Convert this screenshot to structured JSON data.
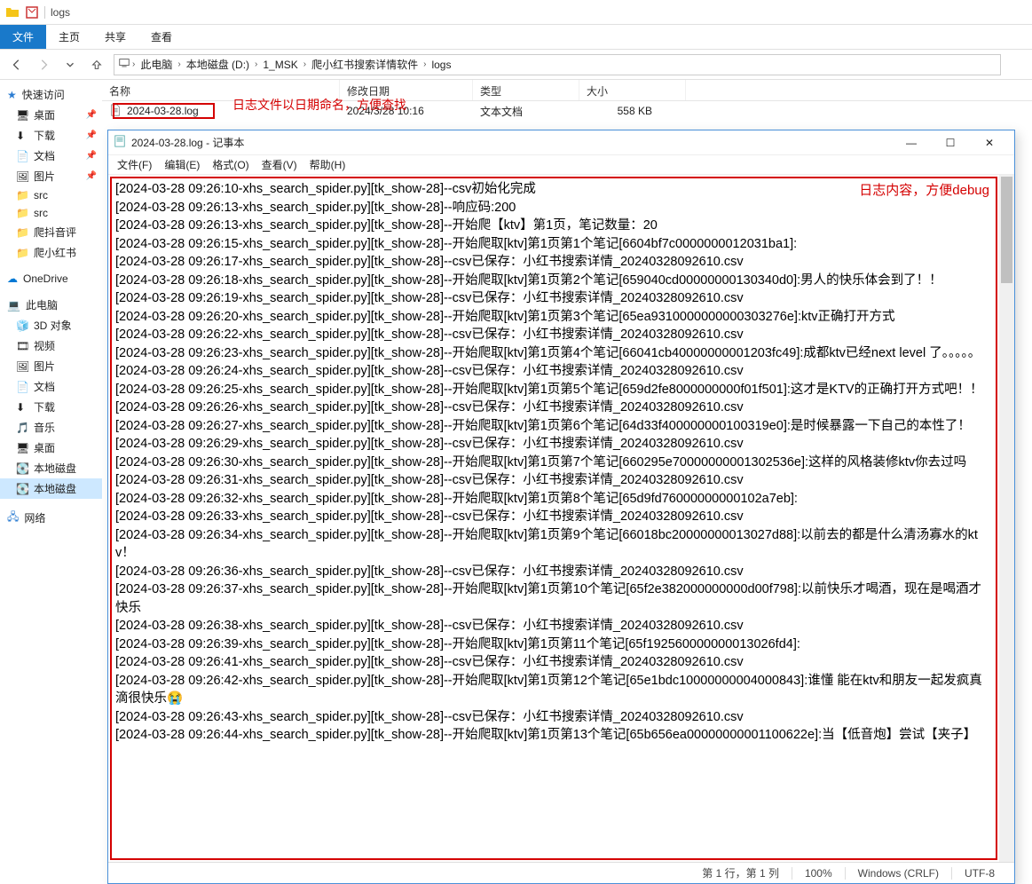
{
  "explorer": {
    "title_suffix": "logs",
    "ribbon": {
      "file": "文件",
      "home": "主页",
      "share": "共享",
      "view": "查看"
    },
    "nav": {
      "back": "←",
      "forward": "→",
      "up": "↑"
    },
    "breadcrumb": [
      "此电脑",
      "本地磁盘 (D:)",
      "1_MSK",
      "爬小红书搜索详情软件",
      "logs"
    ],
    "columns": {
      "name": "名称",
      "modified": "修改日期",
      "type": "类型",
      "size": "大小"
    },
    "file": {
      "name": "2024-03-28.log",
      "modified": "2024/3/28 10:16",
      "type": "文本文档",
      "size": "558 KB",
      "icon": "file-icon"
    }
  },
  "annotations": {
    "a1": "日志文件以日期命名，方便查找",
    "a2": "日志内容，方便debug"
  },
  "sidebar": {
    "quick": "快速访问",
    "items_pinned": [
      {
        "label": "桌面",
        "icon": "desktop"
      },
      {
        "label": "下载",
        "icon": "download"
      },
      {
        "label": "文档",
        "icon": "document"
      },
      {
        "label": "图片",
        "icon": "picture"
      }
    ],
    "items_plain": [
      {
        "label": "src",
        "icon": "folder"
      },
      {
        "label": "src",
        "icon": "folder"
      },
      {
        "label": "爬抖音评",
        "icon": "folder"
      },
      {
        "label": "爬小红书",
        "icon": "folder"
      }
    ],
    "onedrive": "OneDrive",
    "thispc": "此电脑",
    "pc_items": [
      {
        "label": "3D 对象",
        "icon": "3d"
      },
      {
        "label": "视频",
        "icon": "video"
      },
      {
        "label": "图片",
        "icon": "picture"
      },
      {
        "label": "文档",
        "icon": "document"
      },
      {
        "label": "下载",
        "icon": "download"
      },
      {
        "label": "音乐",
        "icon": "music"
      },
      {
        "label": "桌面",
        "icon": "desktop"
      },
      {
        "label": "本地磁盘",
        "icon": "drive"
      },
      {
        "label": "本地磁盘",
        "icon": "drive",
        "selected": true
      }
    ],
    "network": "网络"
  },
  "notepad": {
    "title": "2024-03-28.log - 记事本",
    "menu": {
      "file": "文件(F)",
      "edit": "编辑(E)",
      "format": "格式(O)",
      "view": "查看(V)",
      "help": "帮助(H)"
    },
    "status": {
      "pos": "第 1 行，第 1 列",
      "zoom": "100%",
      "eol": "Windows (CRLF)",
      "enc": "UTF-8"
    },
    "log_lines": [
      "[2024-03-28 09:26:10-xhs_search_spider.py][tk_show-28]--csv初始化完成",
      "[2024-03-28 09:26:13-xhs_search_spider.py][tk_show-28]--响应码:200",
      "[2024-03-28 09:26:13-xhs_search_spider.py][tk_show-28]--开始爬【ktv】第1页，笔记数量：20",
      "[2024-03-28 09:26:15-xhs_search_spider.py][tk_show-28]--开始爬取[ktv]第1页第1个笔记[6604bf7c0000000012031ba1]:",
      "[2024-03-28 09:26:17-xhs_search_spider.py][tk_show-28]--csv已保存：小红书搜索详情_20240328092610.csv",
      "[2024-03-28 09:26:18-xhs_search_spider.py][tk_show-28]--开始爬取[ktv]第1页第2个笔记[659040cd00000000130340d0]:男人的快乐体会到了！！",
      "[2024-03-28 09:26:19-xhs_search_spider.py][tk_show-28]--csv已保存：小红书搜索详情_20240328092610.csv",
      "[2024-03-28 09:26:20-xhs_search_spider.py][tk_show-28]--开始爬取[ktv]第1页第3个笔记[65ea9310000000000303276e]:ktv正确打开方式",
      "[2024-03-28 09:26:22-xhs_search_spider.py][tk_show-28]--csv已保存：小红书搜索详情_20240328092610.csv",
      "[2024-03-28 09:26:23-xhs_search_spider.py][tk_show-28]--开始爬取[ktv]第1页第4个笔记[66041cb40000000001203fc49]:成都ktv已经next level 了。。。。。",
      "[2024-03-28 09:26:24-xhs_search_spider.py][tk_show-28]--csv已保存：小红书搜索详情_20240328092610.csv",
      "[2024-03-28 09:26:25-xhs_search_spider.py][tk_show-28]--开始爬取[ktv]第1页第5个笔记[659d2fe8000000000f01f501]:这才是KTV的正确打开方式吧！！",
      "[2024-03-28 09:26:26-xhs_search_spider.py][tk_show-28]--csv已保存：小红书搜索详情_20240328092610.csv",
      "[2024-03-28 09:26:27-xhs_search_spider.py][tk_show-28]--开始爬取[ktv]第1页第6个笔记[64d33f400000000100319e0]:是时候暴露一下自己的本性了！",
      "[2024-03-28 09:26:29-xhs_search_spider.py][tk_show-28]--csv已保存：小红书搜索详情_20240328092610.csv",
      "[2024-03-28 09:26:30-xhs_search_spider.py][tk_show-28]--开始爬取[ktv]第1页第7个笔记[660295e70000000001302536e]:这样的风格装修ktv你去过吗",
      "[2024-03-28 09:26:31-xhs_search_spider.py][tk_show-28]--csv已保存：小红书搜索详情_20240328092610.csv",
      "[2024-03-28 09:26:32-xhs_search_spider.py][tk_show-28]--开始爬取[ktv]第1页第8个笔记[65d9fd76000000000102a7eb]:",
      "[2024-03-28 09:26:33-xhs_search_spider.py][tk_show-28]--csv已保存：小红书搜索详情_20240328092610.csv",
      "[2024-03-28 09:26:34-xhs_search_spider.py][tk_show-28]--开始爬取[ktv]第1页第9个笔记[66018bc20000000013027d88]:以前去的都是什么清汤寡水的ktv！",
      "[2024-03-28 09:26:36-xhs_search_spider.py][tk_show-28]--csv已保存：小红书搜索详情_20240328092610.csv",
      "[2024-03-28 09:26:37-xhs_search_spider.py][tk_show-28]--开始爬取[ktv]第1页第10个笔记[65f2e382000000000d00f798]:以前快乐才喝酒，现在是喝酒才快乐",
      "[2024-03-28 09:26:38-xhs_search_spider.py][tk_show-28]--csv已保存：小红书搜索详情_20240328092610.csv",
      "[2024-03-28 09:26:39-xhs_search_spider.py][tk_show-28]--开始爬取[ktv]第1页第11个笔记[65f192560000000013026fd4]:",
      "[2024-03-28 09:26:41-xhs_search_spider.py][tk_show-28]--csv已保存：小红书搜索详情_20240328092610.csv",
      "[2024-03-28 09:26:42-xhs_search_spider.py][tk_show-28]--开始爬取[ktv]第1页第12个笔记[65e1bdc10000000004000843]:谁懂 能在ktv和朋友一起发疯真滴很快乐😭",
      "[2024-03-28 09:26:43-xhs_search_spider.py][tk_show-28]--csv已保存：小红书搜索详情_20240328092610.csv",
      "[2024-03-28 09:26:44-xhs_search_spider.py][tk_show-28]--开始爬取[ktv]第1页第13个笔记[65b656ea00000000001100622e]:当【低音炮】尝试【夹子】"
    ]
  }
}
